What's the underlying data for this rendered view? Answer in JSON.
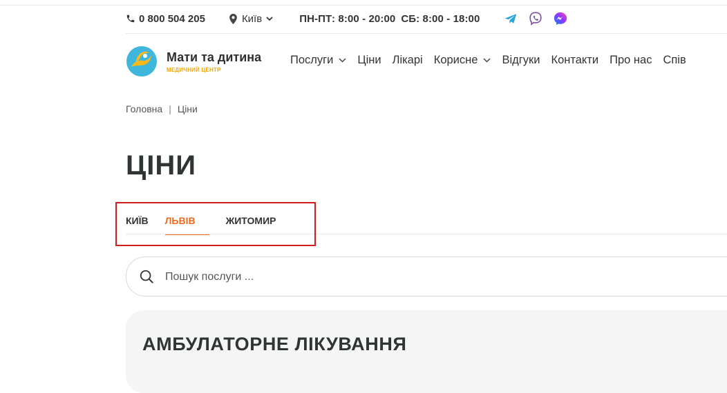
{
  "topbar": {
    "phone": "0 800 504 205",
    "city": "Київ",
    "hours_weekdays": "ПН-ПТ: 8:00 - 20:00",
    "hours_saturday": "СБ: 8:00 - 18:00",
    "socials": [
      "telegram-icon",
      "viber-icon",
      "messenger-icon"
    ]
  },
  "logo": {
    "name": "Мати та дитина",
    "subtitle": "МЕДИЧНИЙ ЦЕНТР"
  },
  "nav": {
    "items": [
      {
        "label": "Послуги",
        "dropdown": true
      },
      {
        "label": "Ціни",
        "dropdown": false
      },
      {
        "label": "Лікарі",
        "dropdown": false
      },
      {
        "label": "Корисне",
        "dropdown": true
      },
      {
        "label": "Відгуки",
        "dropdown": false
      },
      {
        "label": "Контакти",
        "dropdown": false
      },
      {
        "label": "Про нас",
        "dropdown": false
      },
      {
        "label": "Спів",
        "dropdown": false
      }
    ]
  },
  "breadcrumb": {
    "home": "Головна",
    "separator": "|",
    "current": "Ціни"
  },
  "page": {
    "title": "ЦІНИ"
  },
  "tabs": {
    "items": [
      "КИЇВ",
      "ЛЬВІВ",
      "ЖИТОМИР"
    ],
    "active": "ЛЬВІВ"
  },
  "search": {
    "placeholder": "Пошук послуги ..."
  },
  "section": {
    "title": "АМБУЛАТОРНЕ ЛІКУВАННЯ"
  },
  "colors": {
    "accent": "#ef6a1b",
    "highlight_box": "#d11a1a",
    "telegram": "#2aa3e0",
    "viber": "#7b519d",
    "logo_blue": "#3fb6dc",
    "logo_yellow": "#f6b81a"
  }
}
